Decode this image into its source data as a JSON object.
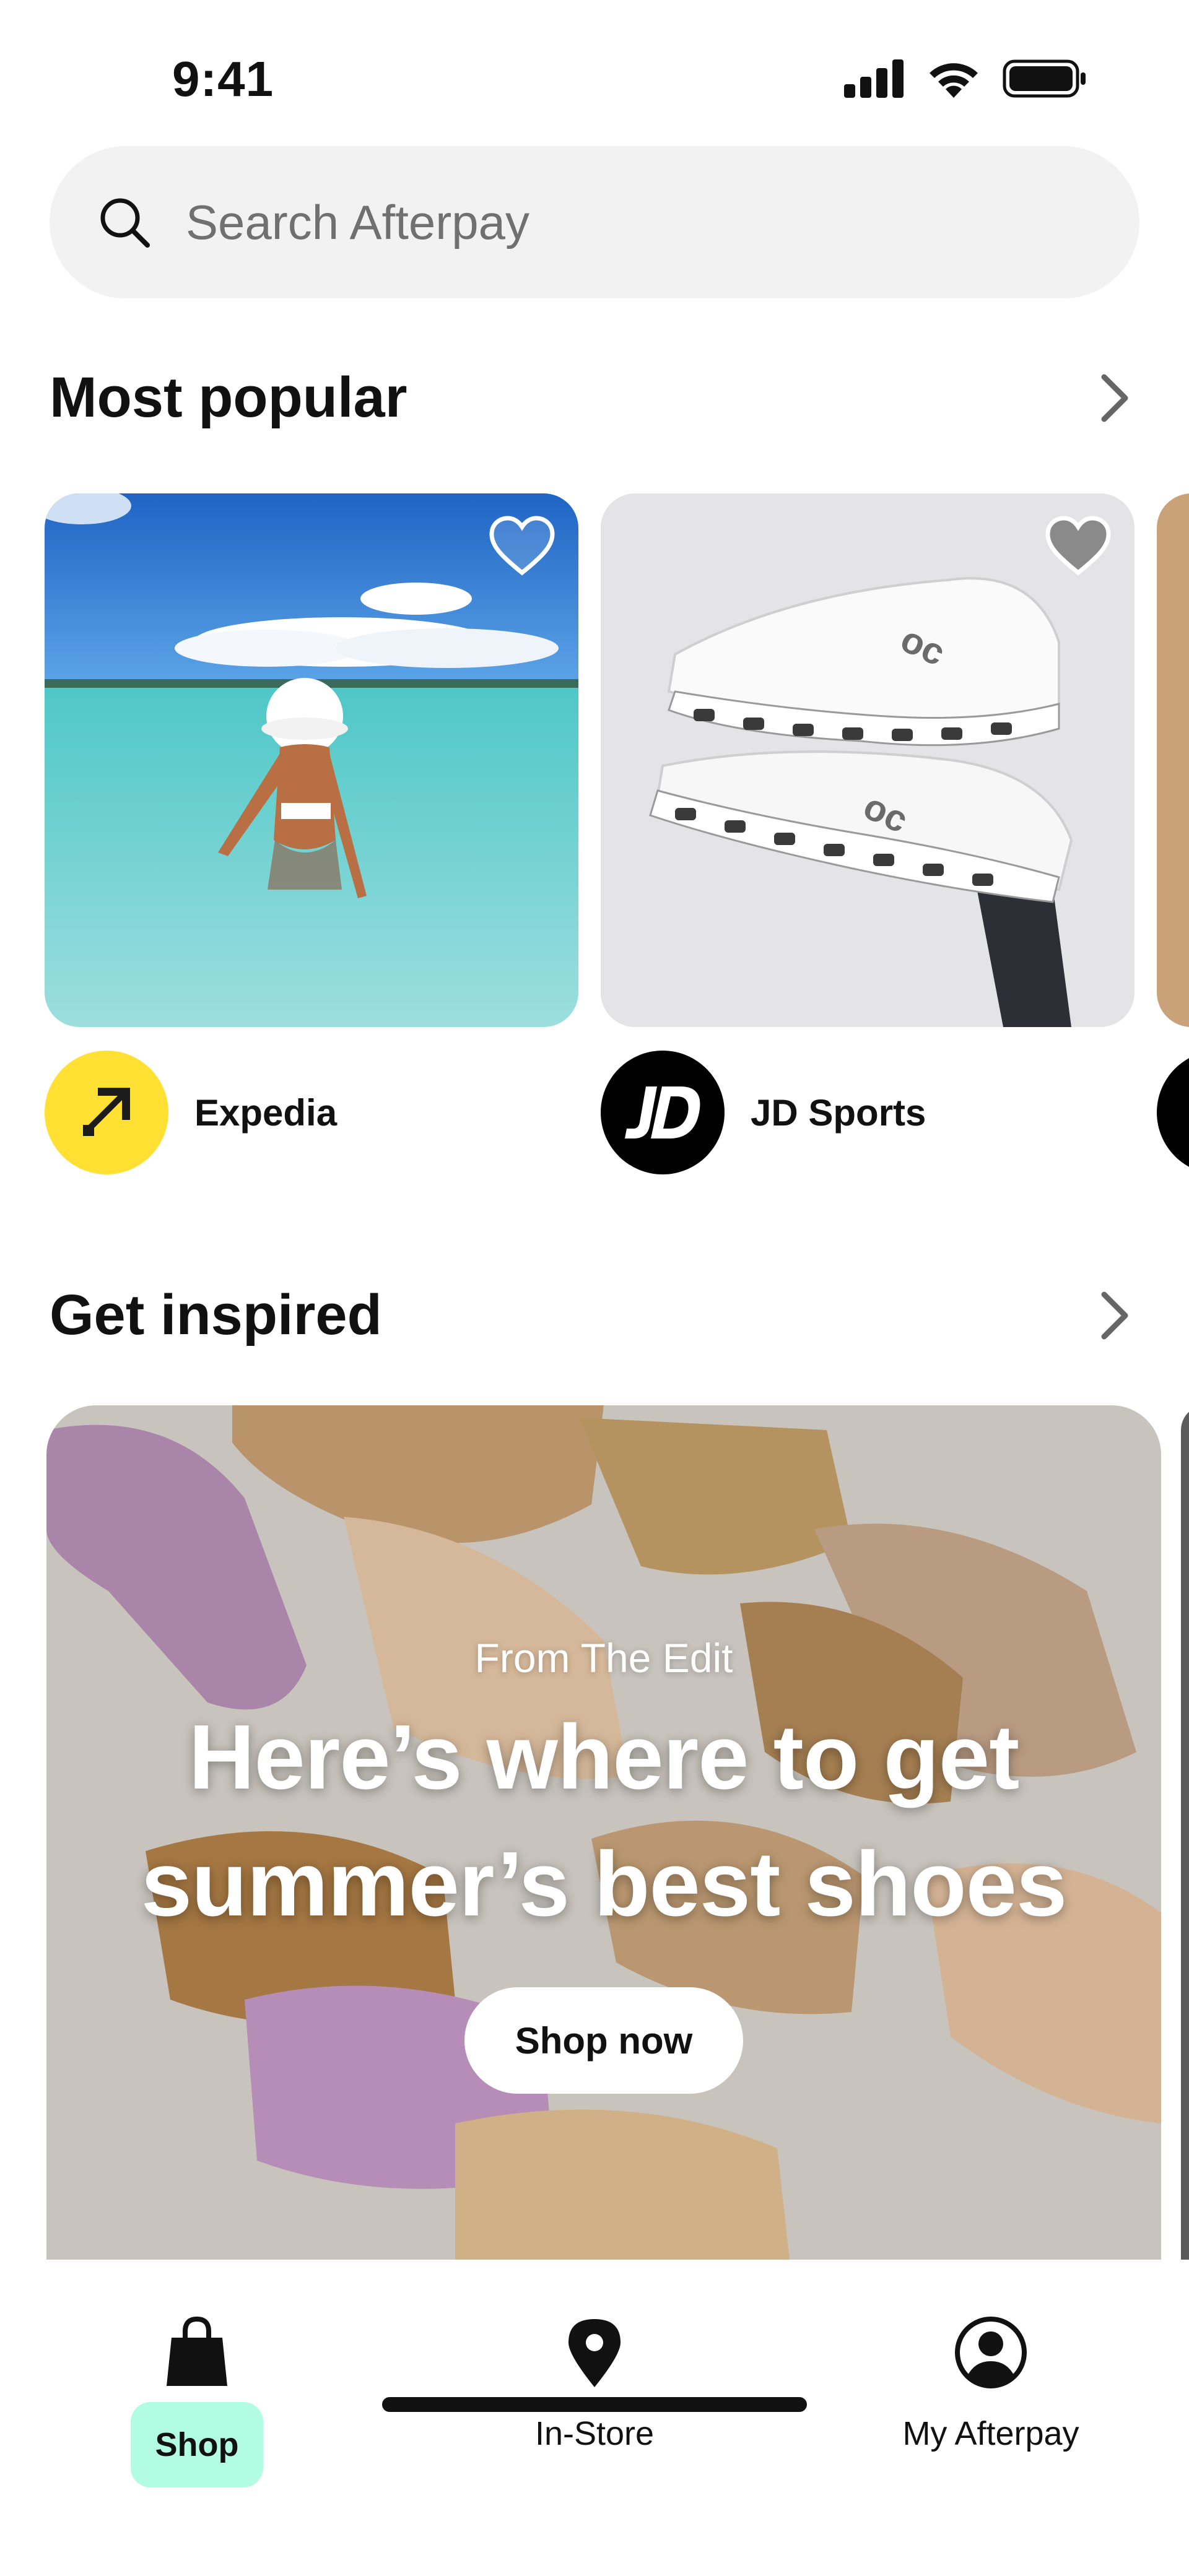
{
  "status_bar": {
    "time": "9:41",
    "icons": [
      "cellular-signal-icon",
      "wifi-icon",
      "battery-icon"
    ]
  },
  "search": {
    "placeholder": "Search Afterpay",
    "icon": "search-icon"
  },
  "most_popular": {
    "title": "Most popular",
    "cards": [
      {
        "merchant": "Expedia",
        "logo": "expedia-logo",
        "logo_color": "#FFE033",
        "image": "beach-woman-photo"
      },
      {
        "merchant": "JD Sports",
        "logo": "jd-sports-logo",
        "logo_color": "#000000",
        "image": "white-sneakers-photo"
      }
    ]
  },
  "get_inspired": {
    "title": "Get inspired",
    "banner": {
      "eyebrow": "From The Edit",
      "headline_line1": "Here’s where to get",
      "headline_line2": "summer’s best shoes",
      "cta": "Shop now"
    }
  },
  "tab_bar": {
    "tabs": [
      {
        "label": "Shop",
        "icon": "shopping-bag-icon",
        "active": true
      },
      {
        "label": "In-Store",
        "icon": "location-pin-icon",
        "active": false
      },
      {
        "label": "My Afterpay",
        "icon": "account-circle-icon",
        "active": false
      }
    ]
  },
  "colors": {
    "accent_mint": "#B2FCE4",
    "search_bg": "#F2F2F2",
    "text": "#111111"
  }
}
